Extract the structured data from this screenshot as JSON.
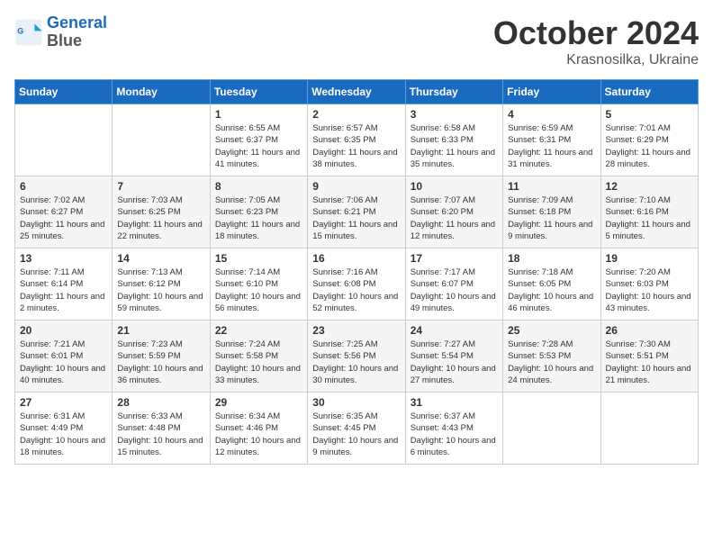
{
  "header": {
    "logo_line1": "General",
    "logo_line2": "Blue",
    "month": "October 2024",
    "location": "Krasnosilka, Ukraine"
  },
  "weekdays": [
    "Sunday",
    "Monday",
    "Tuesday",
    "Wednesday",
    "Thursday",
    "Friday",
    "Saturday"
  ],
  "weeks": [
    [
      {
        "day": "",
        "sunrise": "",
        "sunset": "",
        "daylight": ""
      },
      {
        "day": "",
        "sunrise": "",
        "sunset": "",
        "daylight": ""
      },
      {
        "day": "1",
        "sunrise": "Sunrise: 6:55 AM",
        "sunset": "Sunset: 6:37 PM",
        "daylight": "Daylight: 11 hours and 41 minutes."
      },
      {
        "day": "2",
        "sunrise": "Sunrise: 6:57 AM",
        "sunset": "Sunset: 6:35 PM",
        "daylight": "Daylight: 11 hours and 38 minutes."
      },
      {
        "day": "3",
        "sunrise": "Sunrise: 6:58 AM",
        "sunset": "Sunset: 6:33 PM",
        "daylight": "Daylight: 11 hours and 35 minutes."
      },
      {
        "day": "4",
        "sunrise": "Sunrise: 6:59 AM",
        "sunset": "Sunset: 6:31 PM",
        "daylight": "Daylight: 11 hours and 31 minutes."
      },
      {
        "day": "5",
        "sunrise": "Sunrise: 7:01 AM",
        "sunset": "Sunset: 6:29 PM",
        "daylight": "Daylight: 11 hours and 28 minutes."
      }
    ],
    [
      {
        "day": "6",
        "sunrise": "Sunrise: 7:02 AM",
        "sunset": "Sunset: 6:27 PM",
        "daylight": "Daylight: 11 hours and 25 minutes."
      },
      {
        "day": "7",
        "sunrise": "Sunrise: 7:03 AM",
        "sunset": "Sunset: 6:25 PM",
        "daylight": "Daylight: 11 hours and 22 minutes."
      },
      {
        "day": "8",
        "sunrise": "Sunrise: 7:05 AM",
        "sunset": "Sunset: 6:23 PM",
        "daylight": "Daylight: 11 hours and 18 minutes."
      },
      {
        "day": "9",
        "sunrise": "Sunrise: 7:06 AM",
        "sunset": "Sunset: 6:21 PM",
        "daylight": "Daylight: 11 hours and 15 minutes."
      },
      {
        "day": "10",
        "sunrise": "Sunrise: 7:07 AM",
        "sunset": "Sunset: 6:20 PM",
        "daylight": "Daylight: 11 hours and 12 minutes."
      },
      {
        "day": "11",
        "sunrise": "Sunrise: 7:09 AM",
        "sunset": "Sunset: 6:18 PM",
        "daylight": "Daylight: 11 hours and 9 minutes."
      },
      {
        "day": "12",
        "sunrise": "Sunrise: 7:10 AM",
        "sunset": "Sunset: 6:16 PM",
        "daylight": "Daylight: 11 hours and 5 minutes."
      }
    ],
    [
      {
        "day": "13",
        "sunrise": "Sunrise: 7:11 AM",
        "sunset": "Sunset: 6:14 PM",
        "daylight": "Daylight: 11 hours and 2 minutes."
      },
      {
        "day": "14",
        "sunrise": "Sunrise: 7:13 AM",
        "sunset": "Sunset: 6:12 PM",
        "daylight": "Daylight: 10 hours and 59 minutes."
      },
      {
        "day": "15",
        "sunrise": "Sunrise: 7:14 AM",
        "sunset": "Sunset: 6:10 PM",
        "daylight": "Daylight: 10 hours and 56 minutes."
      },
      {
        "day": "16",
        "sunrise": "Sunrise: 7:16 AM",
        "sunset": "Sunset: 6:08 PM",
        "daylight": "Daylight: 10 hours and 52 minutes."
      },
      {
        "day": "17",
        "sunrise": "Sunrise: 7:17 AM",
        "sunset": "Sunset: 6:07 PM",
        "daylight": "Daylight: 10 hours and 49 minutes."
      },
      {
        "day": "18",
        "sunrise": "Sunrise: 7:18 AM",
        "sunset": "Sunset: 6:05 PM",
        "daylight": "Daylight: 10 hours and 46 minutes."
      },
      {
        "day": "19",
        "sunrise": "Sunrise: 7:20 AM",
        "sunset": "Sunset: 6:03 PM",
        "daylight": "Daylight: 10 hours and 43 minutes."
      }
    ],
    [
      {
        "day": "20",
        "sunrise": "Sunrise: 7:21 AM",
        "sunset": "Sunset: 6:01 PM",
        "daylight": "Daylight: 10 hours and 40 minutes."
      },
      {
        "day": "21",
        "sunrise": "Sunrise: 7:23 AM",
        "sunset": "Sunset: 5:59 PM",
        "daylight": "Daylight: 10 hours and 36 minutes."
      },
      {
        "day": "22",
        "sunrise": "Sunrise: 7:24 AM",
        "sunset": "Sunset: 5:58 PM",
        "daylight": "Daylight: 10 hours and 33 minutes."
      },
      {
        "day": "23",
        "sunrise": "Sunrise: 7:25 AM",
        "sunset": "Sunset: 5:56 PM",
        "daylight": "Daylight: 10 hours and 30 minutes."
      },
      {
        "day": "24",
        "sunrise": "Sunrise: 7:27 AM",
        "sunset": "Sunset: 5:54 PM",
        "daylight": "Daylight: 10 hours and 27 minutes."
      },
      {
        "day": "25",
        "sunrise": "Sunrise: 7:28 AM",
        "sunset": "Sunset: 5:53 PM",
        "daylight": "Daylight: 10 hours and 24 minutes."
      },
      {
        "day": "26",
        "sunrise": "Sunrise: 7:30 AM",
        "sunset": "Sunset: 5:51 PM",
        "daylight": "Daylight: 10 hours and 21 minutes."
      }
    ],
    [
      {
        "day": "27",
        "sunrise": "Sunrise: 6:31 AM",
        "sunset": "Sunset: 4:49 PM",
        "daylight": "Daylight: 10 hours and 18 minutes."
      },
      {
        "day": "28",
        "sunrise": "Sunrise: 6:33 AM",
        "sunset": "Sunset: 4:48 PM",
        "daylight": "Daylight: 10 hours and 15 minutes."
      },
      {
        "day": "29",
        "sunrise": "Sunrise: 6:34 AM",
        "sunset": "Sunset: 4:46 PM",
        "daylight": "Daylight: 10 hours and 12 minutes."
      },
      {
        "day": "30",
        "sunrise": "Sunrise: 6:35 AM",
        "sunset": "Sunset: 4:45 PM",
        "daylight": "Daylight: 10 hours and 9 minutes."
      },
      {
        "day": "31",
        "sunrise": "Sunrise: 6:37 AM",
        "sunset": "Sunset: 4:43 PM",
        "daylight": "Daylight: 10 hours and 6 minutes."
      },
      {
        "day": "",
        "sunrise": "",
        "sunset": "",
        "daylight": ""
      },
      {
        "day": "",
        "sunrise": "",
        "sunset": "",
        "daylight": ""
      }
    ]
  ]
}
